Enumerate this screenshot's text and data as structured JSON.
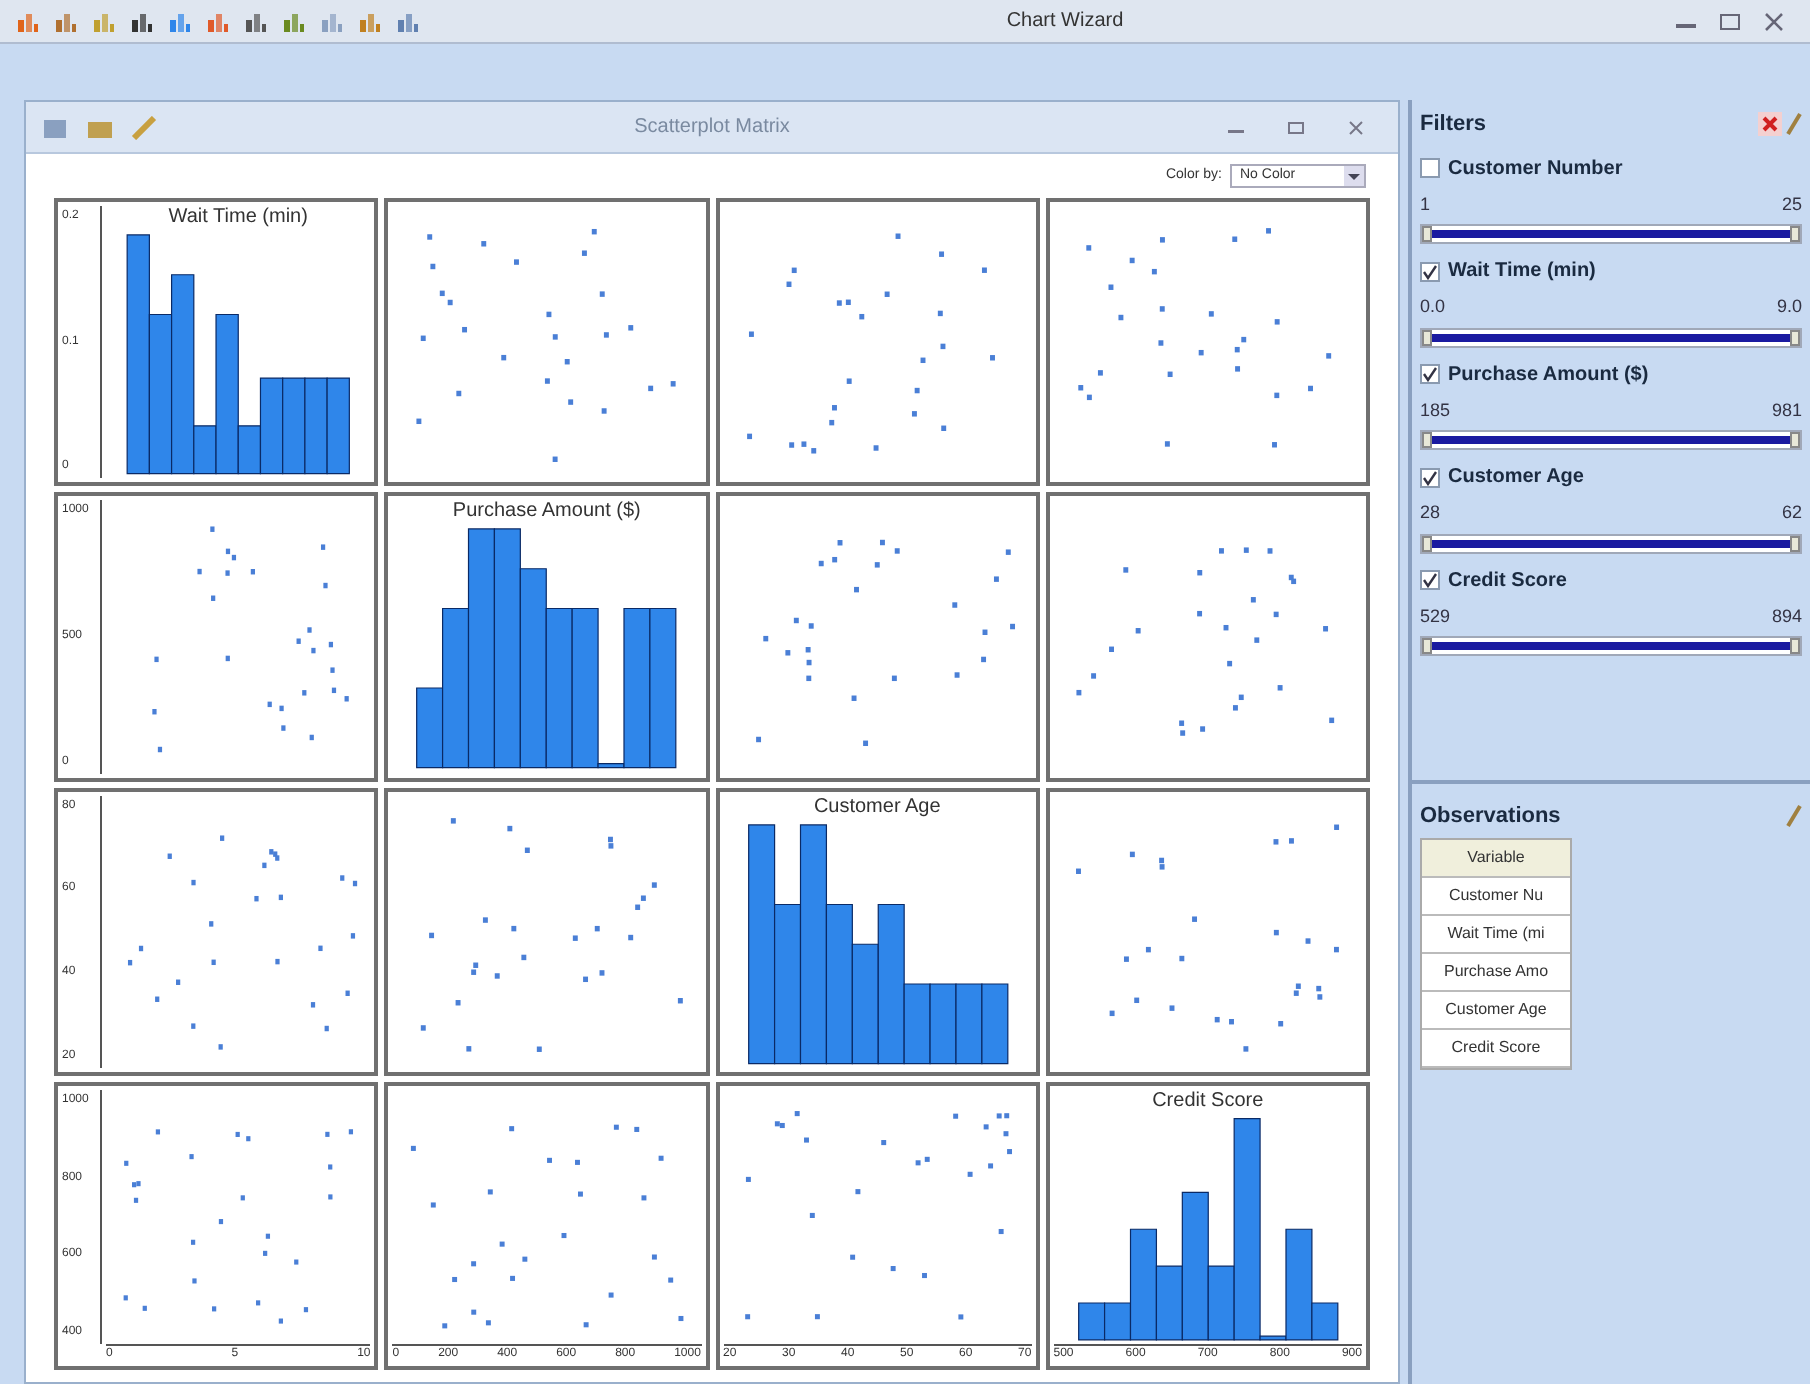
{
  "window": {
    "title": "Chart Wizard"
  },
  "chart_window": {
    "title": "Scatterplot Matrix",
    "color_by": {
      "label": "Color by:",
      "value": "No Color"
    }
  },
  "matrix": {
    "rows": [
      {
        "y_ticks": [
          "0.2",
          "0.1",
          "0"
        ],
        "cells": [
          {
            "kind": "histogram",
            "title": "Wait Time (min)"
          },
          {
            "kind": "scatter"
          },
          {
            "kind": "scatter"
          },
          {
            "kind": "scatter"
          }
        ]
      },
      {
        "y_ticks": [
          "1000",
          "500",
          "0"
        ],
        "cells": [
          {
            "kind": "scatter"
          },
          {
            "kind": "histogram",
            "title": "Purchase Amount ($)"
          },
          {
            "kind": "scatter"
          },
          {
            "kind": "scatter"
          }
        ]
      },
      {
        "y_ticks": [
          "80",
          "60",
          "40",
          "20"
        ],
        "cells": [
          {
            "kind": "scatter"
          },
          {
            "kind": "scatter"
          },
          {
            "kind": "histogram",
            "title": "Customer Age"
          },
          {
            "kind": "scatter"
          }
        ]
      },
      {
        "y_ticks": [
          "1000",
          "800",
          "600",
          "400"
        ],
        "cells": [
          {
            "kind": "scatter"
          },
          {
            "kind": "scatter"
          },
          {
            "kind": "scatter"
          },
          {
            "kind": "histogram",
            "title": "Credit Score"
          }
        ]
      }
    ],
    "x_ticks": [
      [
        "0",
        "5",
        "10"
      ],
      [
        "0",
        "200",
        "400",
        "600",
        "800",
        "1000"
      ],
      [
        "20",
        "30",
        "40",
        "50",
        "60",
        "70"
      ],
      [
        "500",
        "600",
        "700",
        "800",
        "900"
      ]
    ]
  },
  "filters": {
    "title": "Filters",
    "items": [
      {
        "label": "Customer Number",
        "checked": false,
        "min": "1",
        "max": "25",
        "level": 1
      },
      {
        "label": "Wait Time (min)",
        "checked": true,
        "min": "0.0",
        "max": "9.0",
        "level": 1
      },
      {
        "label": "Purchase Amount ($)",
        "checked": true,
        "min": "185",
        "max": "981",
        "level": 1
      },
      {
        "label": "Customer Age",
        "checked": true,
        "min": "28",
        "max": "62",
        "level": 1
      },
      {
        "label": "Credit Score",
        "checked": true,
        "min": "529",
        "max": "894",
        "level": 1
      }
    ]
  },
  "observations": {
    "title": "Observations",
    "header": "Variable",
    "rows": [
      "Customer Nu",
      "Wait Time (mi",
      "Purchase Amo",
      "Customer Age",
      "Credit Score"
    ]
  }
}
